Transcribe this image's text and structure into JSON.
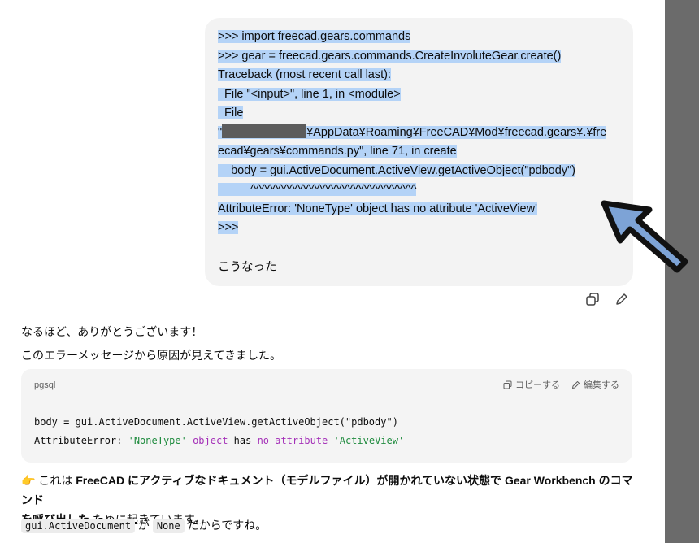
{
  "user_message": {
    "lines": [
      ">>> import freecad.gears.commands",
      ">>> gear = freecad.gears.commands.CreateInvoluteGear.create()",
      "Traceback (most recent call last):",
      "  File \"<input>\", line 1, in <module>",
      "  File",
      "¥AppData¥Roaming¥FreeCAD¥Mod¥freecad.gears¥.¥fre",
      "ecad¥gears¥commands.py\", line 71, in create",
      "    body = gui.ActiveDocument.ActiveView.getActiveObject(\"pdbody\")",
      "          ^^^^^^^^^^^^^^^^^^^^^^^^^^^^^^",
      "AttributeError: 'NoneType' object has no attribute 'ActiveView'",
      ">>>"
    ],
    "line6_prefix": "\"",
    "trailing": "こうなった",
    "colors": {
      "bubble": "#f3f3f3",
      "selection": "#b4d3f7",
      "redaction": "#5c5c5c"
    }
  },
  "message_actions": [
    {
      "name": "copy-icon"
    },
    {
      "name": "edit-icon"
    }
  ],
  "assistant": {
    "line1": "なるほど、ありがとうございます！",
    "line2": "このエラーメッセージから原因が見えてきました。",
    "code_block": {
      "language": "pgsql",
      "copy_label": "コピーする",
      "edit_label": "編集する",
      "line1": "body = gui.ActiveDocument.ActiveView.getActiveObject(\"pdbody\")",
      "line2_parts": {
        "p1": "AttributeError: ",
        "p2": "'NoneType'",
        "p3": " ",
        "p4": "object",
        "p5": " has ",
        "p6": "no attribute",
        "p7": " ",
        "p8": "'ActiveView'"
      },
      "colors": {
        "string": "#1f8b3e",
        "keyword": "#a430b8"
      }
    },
    "explain": {
      "emoji": "👉",
      "t1": " これは ",
      "b1": "FreeCAD にアクティブなドキュメント（モデルファイル）が開かれていない状態で Gear Workbench のコマンド",
      "b2": "を呼び出した",
      "t2": " ために起きています。"
    },
    "note": {
      "code1": "gui.ActiveDocument",
      "t1": " が ",
      "code2": "None",
      "t2": " だからですね。"
    }
  },
  "annotation_arrow": {
    "color": "#7da3d6",
    "outline": "#111111"
  }
}
